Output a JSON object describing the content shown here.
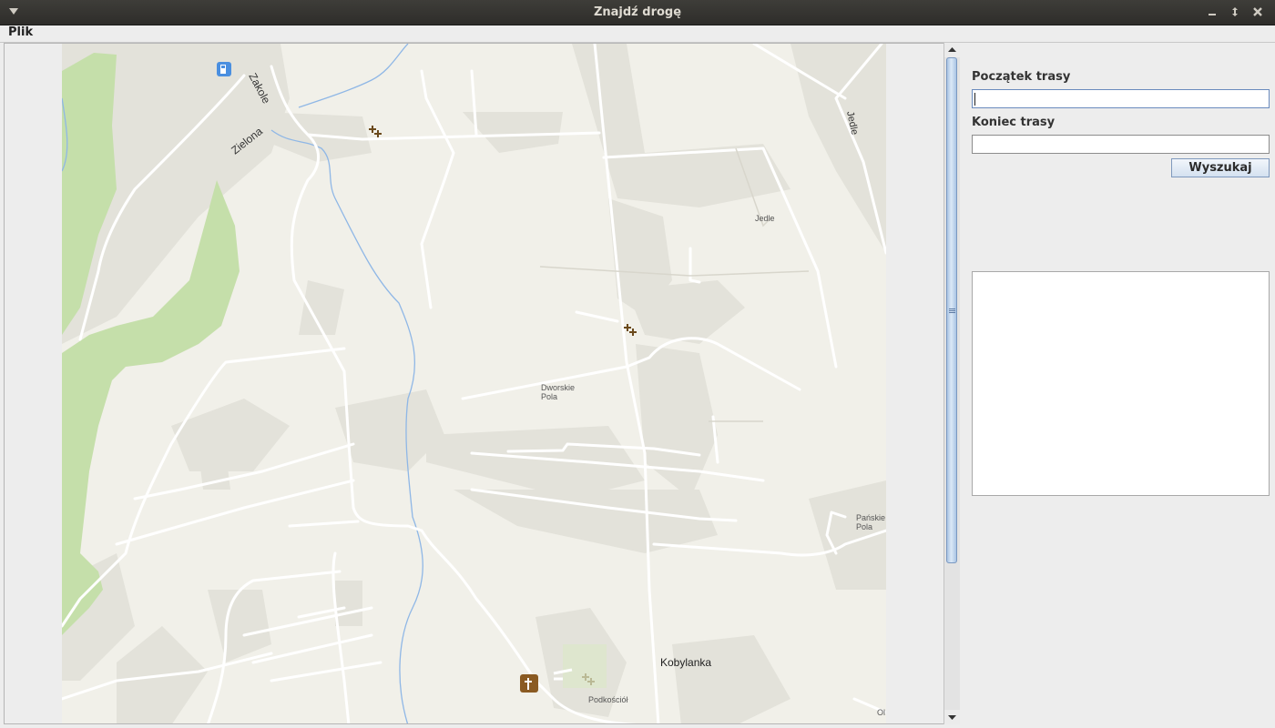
{
  "window": {
    "title": "Znajdź drogę"
  },
  "menubar": {
    "items": [
      {
        "label": "Plik"
      }
    ]
  },
  "map": {
    "labels": {
      "zakole": "Zakole",
      "zielona": "Zielona",
      "jedle_road": "Jedle",
      "jedle_place": "Jedle",
      "dworskie_1": "Dworskie",
      "dworskie_2": "Pola",
      "panskie_1": "Pańskie",
      "panskie_2": "Pola",
      "kobylanka": "Kobylanka",
      "podkosciol": "Podkościół",
      "edge_partial": "Ol"
    },
    "colors": {
      "land": "#f1f0e9",
      "built": "#e3e2da",
      "forest": "#c5dfaa",
      "road": "#ffffff",
      "water": "#8fb7e6"
    }
  },
  "sidebar": {
    "start_label": "Początek trasy",
    "start_value": "",
    "end_label": "Koniec trasy",
    "end_value": "",
    "search_button": "Wyszukaj",
    "results_text": ""
  }
}
